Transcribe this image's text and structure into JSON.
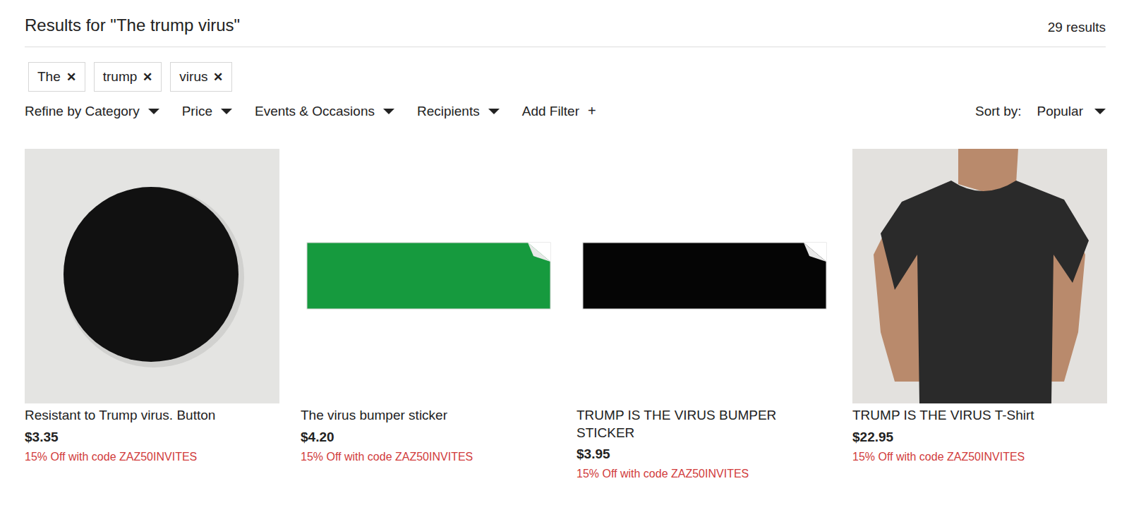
{
  "search": {
    "heading": "Results for \"The trump virus\"",
    "count": "29 results",
    "chips": [
      {
        "label": "The",
        "remove": "✕"
      },
      {
        "label": "trump",
        "remove": "✕"
      },
      {
        "label": "virus",
        "remove": "✕"
      }
    ]
  },
  "filters": [
    {
      "label": "Refine by Category"
    },
    {
      "label": "Price"
    },
    {
      "label": "Events & Occasions"
    },
    {
      "label": "Recipients"
    }
  ],
  "add_filter": {
    "label": "Add Filter",
    "icon": "+"
  },
  "sort": {
    "label": "Sort by:",
    "value": "Popular"
  },
  "products": [
    {
      "name": "Resistant to Trump virus. Button",
      "price": "$3.35",
      "promo": "15% Off with code ZAZ50INVITES",
      "kind": "button",
      "color": "#111111"
    },
    {
      "name": "The virus bumper sticker",
      "price": "$4.20",
      "promo": "15% Off with code ZAZ50INVITES",
      "kind": "sticker",
      "color": "#169a3e"
    },
    {
      "name": "TRUMP IS THE VIRUS BUMPER STICKER",
      "price": "$3.95",
      "promo": "15% Off with code ZAZ50INVITES",
      "kind": "sticker",
      "color": "#050505"
    },
    {
      "name": "TRUMP IS THE VIRUS T-Shirt",
      "price": "$22.95",
      "promo": "15% Off with code ZAZ50INVITES",
      "kind": "shirt",
      "color": "#2a2a2a"
    }
  ]
}
